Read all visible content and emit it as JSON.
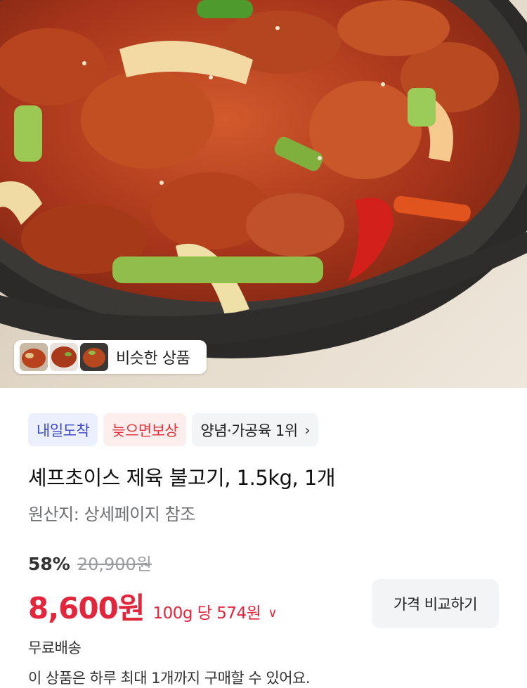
{
  "product_image": {
    "icon": "photo",
    "similar": {
      "label": "비슷한 상품",
      "thumbnails": 3
    }
  },
  "badges": {
    "arrival": "내일도착",
    "late_comp": "늦으면보상",
    "rank": "양념·가공육 1위"
  },
  "product": {
    "title": "셰프초이스 제육 불고기, 1.5kg, 1개",
    "origin": "원산지: 상세페이지 참조"
  },
  "pricing": {
    "discount": "58%",
    "original_price": "20,900원",
    "price": "8,600원",
    "unit_price": "100g 당 574원",
    "compare_label": "가격 비교하기"
  },
  "delivery": {
    "shipping": "무료배송",
    "limit_notice": "이 상품은 하루 최대 1개까지 구매할 수 있어요."
  },
  "colors": {
    "price_red": "#e3263c",
    "badge_blue": "#3a48c9",
    "badge_red": "#e0353d"
  }
}
